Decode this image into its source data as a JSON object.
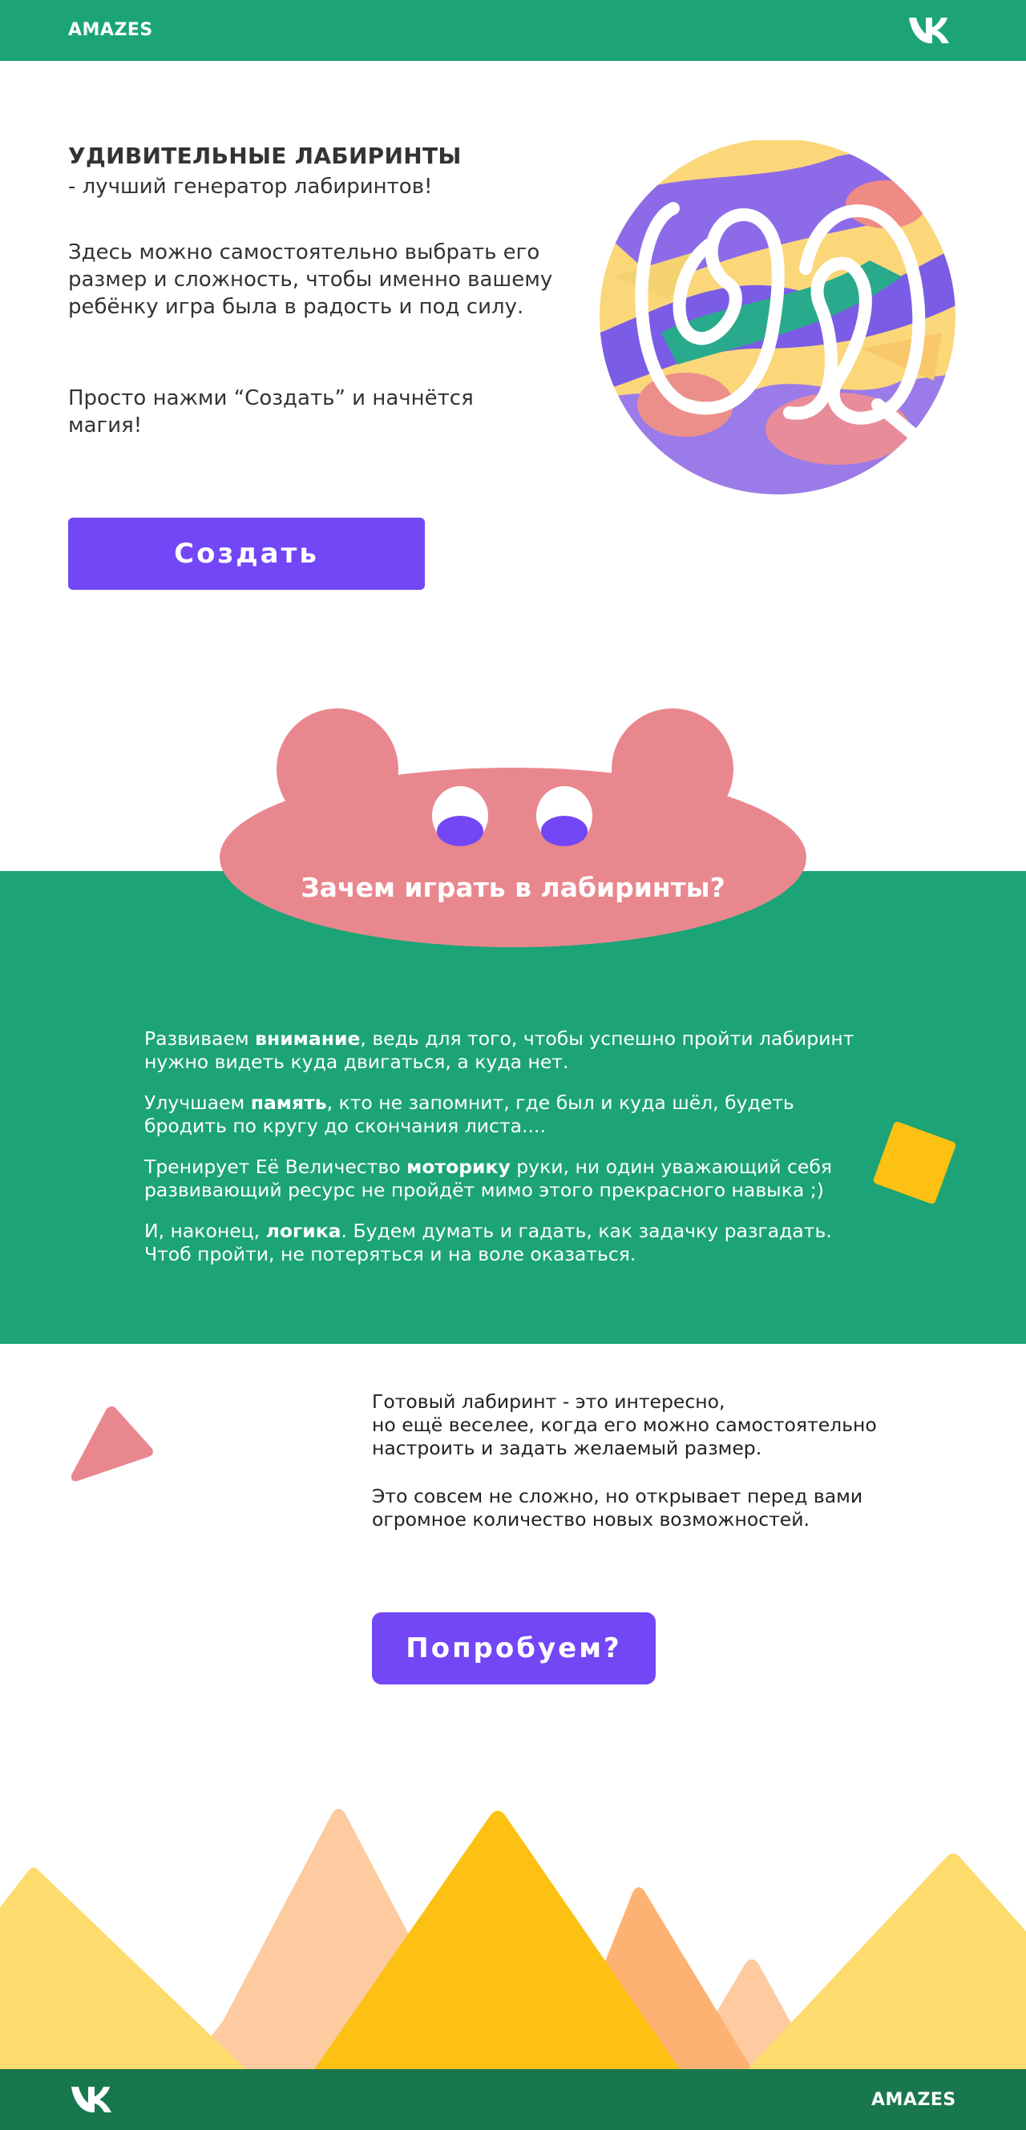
{
  "header": {
    "logo": "AMAZES",
    "social_icon": "vk-icon"
  },
  "hero": {
    "title": "УДИВИТЕЛЬНЫЕ ЛАБИРИНТЫ",
    "subtitle": "- лучший генератор лабиринтов!",
    "paragraph1": "Здесь можно самостоятельно выбрать его размер и сложность, чтобы именно вашему ребёнку игра была в радость и под силу.",
    "paragraph2": "Просто нажми “Создать” и начнётся магия!",
    "create_button": "Создать",
    "logo_icon": "maze-logo-icon"
  },
  "why": {
    "title": "Зачем играть в лабиринты?",
    "items": [
      {
        "before": "Развиваем ",
        "bold": "внимание",
        "after": ", ведь для того, чтобы успешно пройти лабиринт нужно видеть куда двигаться, а куда нет."
      },
      {
        "before": "Улучшаем ",
        "bold": "память",
        "after": ", кто не запомнит, где был и куда шёл, будеть бродить по кругу до скончания листа...."
      },
      {
        "before": "Тренирует Её Величество ",
        "bold": "моторику",
        "after": " руки, ни один уважающий себя развивающий ресурс не пройдёт мимо этого прекрасного навыка ;)"
      },
      {
        "before": "И, наконец, ",
        "bold": "логика",
        "after": ". Будем думать и гадать, как задачку разгадать. Чтоб пройти, не потеряться и на воле оказаться."
      }
    ]
  },
  "custom": {
    "paragraph1_line1": "Готовый лабиринт - это интересно,",
    "paragraph1_line2": "но ещё веселее, когда его можно самостоятельно настроить и задать желаемый размер.",
    "paragraph2": "Это совсем не сложно, но открывает перед вами огромное количество новых возможностей.",
    "try_button": "Попробуем?"
  },
  "footer": {
    "logo": "AMAZES",
    "social_icon": "vk-icon"
  },
  "colors": {
    "green": "#1ca476",
    "dark_green": "#19774e",
    "purple": "#7346f6",
    "pink": "#e9878f",
    "yellow": "#fcc112",
    "light_yellow": "#fddb6d",
    "peach": "#fdcb9f",
    "orange": "#fdb173"
  }
}
